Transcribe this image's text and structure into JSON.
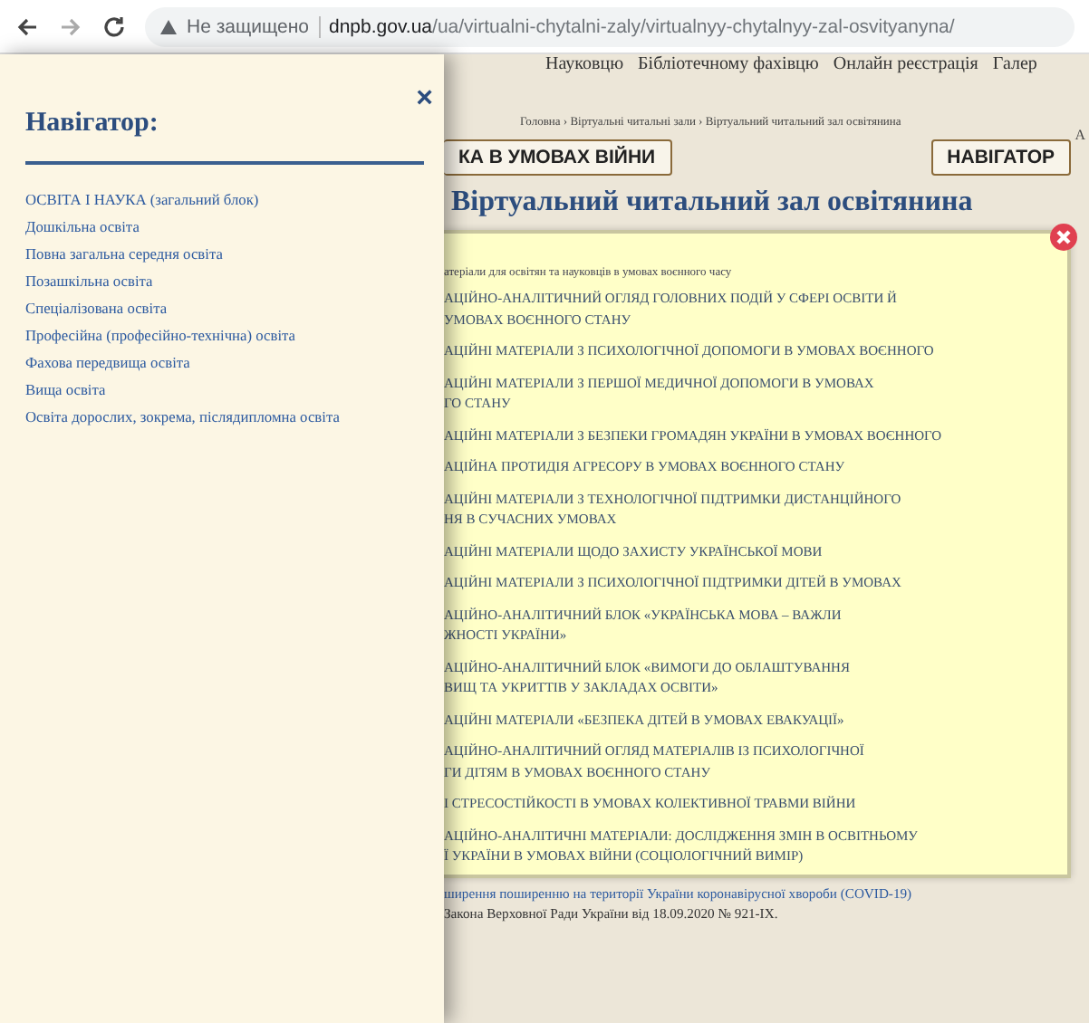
{
  "browser": {
    "security": "Не защищено",
    "url_domain": "dnpb.gov.ua",
    "url_path": "/ua/virtualni-chytalni-zaly/virtualnyy-chytalnyy-zal-osvityanyna/"
  },
  "navigator": {
    "title": "Навігатор:",
    "close": "×",
    "items": [
      "ОСВІТА І НАУКА (загальний блок)",
      "Дошкільна освіта",
      "Повна загальна середня освіта",
      "Позашкільна освіта",
      "Спеціалізована освіта",
      "Професійна (професійно-технічна) освіта",
      "Фахова передвища освіта",
      "Вища освіта",
      "Освіта дорослих, зокрема, післядипломна освіта"
    ]
  },
  "site": {
    "top_menu": [
      "Науковцю",
      "Бібліотечному фахівцю",
      "Онлайн реєстрація",
      "Галер"
    ],
    "breadcrumb": "Головна › Віртуальні читальні зали › Віртуальний читальний зал освітянина",
    "side_letter": "А",
    "section_button": "КА В УМОВАХ ВІЙНИ",
    "navigator_button": "НАВІГАТОР",
    "title": "Віртуальний читальний зал освітянина",
    "bottom_lines": [
      "ширення поширенню на території України коронавірусної хвороби (COVID-19)",
      "Закона Верховної Ради України від 18.09.2020 № 921-IX."
    ]
  },
  "popup": {
    "heading": "атеріали для освітян та науковців в умовах воєнного часу",
    "items": [
      {
        "lines": [
          "АЦІЙНО-АНАЛІТИЧНИЙ ОГЛЯД ГОЛОВНИХ ПОДІЙ У СФЕРІ ОСВІТИ Й",
          "УМОВАХ ВОЄННОГО СТАНУ"
        ]
      },
      {
        "lines": [
          "АЦІЙНІ МАТЕРІАЛИ З ПСИХОЛОГІЧНОЇ ДОПОМОГИ В УМОВАХ ВОЄННОГО"
        ]
      },
      {
        "lines": [
          "АЦІЙНІ МАТЕРІАЛИ З ПЕРШОЇ МЕДИЧНОЇ ДОПОМОГИ В УМОВАХ",
          "ГО СТАНУ"
        ]
      },
      {
        "lines": [
          "АЦІЙНІ МАТЕРІАЛИ З БЕЗПЕКИ ГРОМАДЯН УКРАЇНИ В УМОВАХ ВОЄННОГО"
        ]
      },
      {
        "lines": [
          "АЦІЙНА ПРОТИДІЯ АГРЕСОРУ В УМОВАХ ВОЄННОГО СТАНУ"
        ]
      },
      {
        "lines": [
          "АЦІЙНІ МАТЕРІАЛИ З ТЕХНОЛОГІЧНОЇ ПІДТРИМКИ ДИСТАНЦІЙНОГО",
          "НЯ В СУЧАСНИХ УМОВАХ"
        ]
      },
      {
        "lines": [
          "АЦІЙНІ МАТЕРІАЛИ ЩОДО ЗАХИСТУ УКРАЇНСЬКОЇ МОВИ"
        ]
      },
      {
        "lines": [
          "АЦІЙНІ МАТЕРІАЛИ З ПСИХОЛОГІЧНОЇ ПІДТРИМКИ ДІТЕЙ В УМОВАХ"
        ]
      },
      {
        "lines": [
          "АЦІЙНО-АНАЛІТИЧНИЙ БЛОК «УКРАЇНСЬКА МОВА – ВАЖЛИ",
          "ЖНОСТІ УКРАЇНИ»"
        ]
      },
      {
        "lines": [
          "АЦІЙНО-АНАЛІТИЧНИЙ БЛОК «ВИМОГИ ДО ОБЛАШТУВАННЯ",
          "ВИЩ ТА УКРИТТІВ У ЗАКЛАДАХ ОСВІТИ»"
        ]
      },
      {
        "lines": [
          "АЦІЙНІ МАТЕРІАЛИ «БЕЗПЕКА ДІТЕЙ В УМОВАХ ЕВАКУАЦІЇ»"
        ]
      },
      {
        "lines": [
          "АЦІЙНО-АНАЛІТИЧНИЙ ОГЛЯД МАТЕРІАЛІВ ІЗ ПСИХОЛОГІЧНОЇ",
          "ГИ ДІТЯМ В УМОВАХ ВОЄННОГО СТАНУ"
        ]
      },
      {
        "lines": [
          "І СТРЕСОСТІЙКОСТІ В УМОВАХ КОЛЕКТИВНОЇ ТРАВМИ ВІЙНИ"
        ]
      },
      {
        "lines": [
          "АЦІЙНО-АНАЛІТИЧНІ МАТЕРІАЛИ: ДОСЛІДЖЕННЯ ЗМІН В ОСВІТНЬОМУ",
          "Ї УКРАЇНИ В УМОВАХ ВІЙНИ (СОЦІОЛОГІЧНИЙ ВИМІР)"
        ]
      }
    ]
  }
}
